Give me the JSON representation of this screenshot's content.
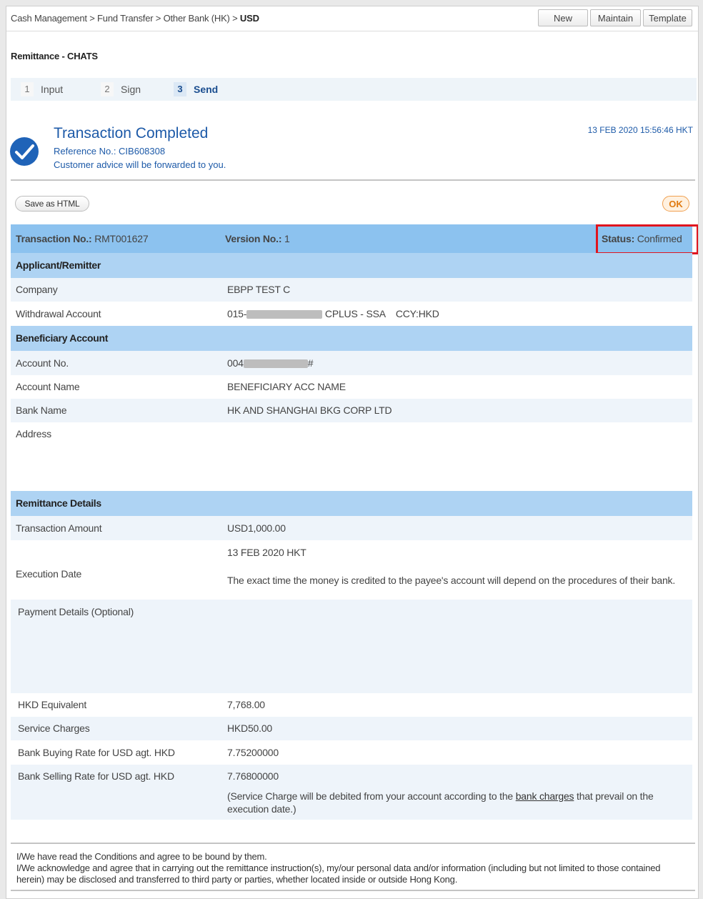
{
  "breadcrumb": {
    "path": "Cash Management > Fund Transfer > Other Bank (HK) > ",
    "current": "USD"
  },
  "toolbar": {
    "new": "New",
    "maintain": "Maintain",
    "template": "Template"
  },
  "page_title": "Remittance - CHATS",
  "steps": [
    {
      "num": "1",
      "label": "Input"
    },
    {
      "num": "2",
      "label": "Sign"
    },
    {
      "num": "3",
      "label": "Send"
    }
  ],
  "result": {
    "title": "Transaction Completed",
    "reference": "Reference No.: CIB608308",
    "advice": "Customer advice will be forwarded to you.",
    "timestamp": "13 FEB 2020 15:56:46 HKT"
  },
  "actions": {
    "save_html": "Save as HTML",
    "ok": "OK"
  },
  "header": {
    "txn_label": "Transaction No.:",
    "txn_value": "RMT001627",
    "ver_label": "Version No.:",
    "ver_value": "1",
    "status_label": "Status:",
    "status_value": "Confirmed"
  },
  "sections": {
    "applicant": "Applicant/Remitter",
    "beneficiary": "Beneficiary Account",
    "remittance": "Remittance Details"
  },
  "applicant": {
    "company_label": "Company",
    "company_value": "EBPP TEST C",
    "withdrawal_label": "Withdrawal Account",
    "withdrawal_prefix": "015-",
    "withdrawal_suffix": " CPLUS - SSA    CCY:HKD"
  },
  "beneficiary": {
    "acct_no_label": "Account No.",
    "acct_no_prefix": "004",
    "acct_no_suffix": "#",
    "acct_name_label": "Account Name",
    "acct_name_value": "BENEFICIARY ACC NAME",
    "bank_label": "Bank Name",
    "bank_value": "HK AND SHANGHAI BKG CORP LTD",
    "address_label": "Address"
  },
  "remittance": {
    "amount_label": "Transaction Amount",
    "amount_value": "USD1,000.00",
    "exec_label": "Execution Date",
    "exec_value": "13 FEB 2020 HKT",
    "exec_note": "The exact time the money is credited to the payee's account will depend on the procedures of their bank.",
    "payment_label": "Payment Details (Optional)",
    "hkd_label": "HKD Equivalent",
    "hkd_value": "7,768.00",
    "charges_label": "Service Charges",
    "charges_value": "HKD50.00",
    "buy_label": "Bank Buying Rate for USD agt. HKD",
    "buy_value": "7.75200000",
    "sell_label": "Bank Selling Rate for USD agt. HKD",
    "sell_value": "7.76800000",
    "note_pre": "(Service Charge will be debited from your account according to the ",
    "note_link": "bank charges",
    "note_post": " that prevail on the execution date.)"
  },
  "terms": {
    "line1": "I/We have read the Conditions and agree to be bound by them.",
    "line2": "I/We acknowledge and agree that in carrying out the remittance instruction(s), my/our personal data and/or information (including but not limited to those contained herein) may be disclosed and transferred to third party or parties, whether located inside or outside Hong Kong."
  },
  "colors": {
    "accent": "#1d5aa8",
    "section": "#aed3f3",
    "header": "#8cc2ef",
    "status_box": "#e0141e",
    "ok": "#e07a10"
  }
}
